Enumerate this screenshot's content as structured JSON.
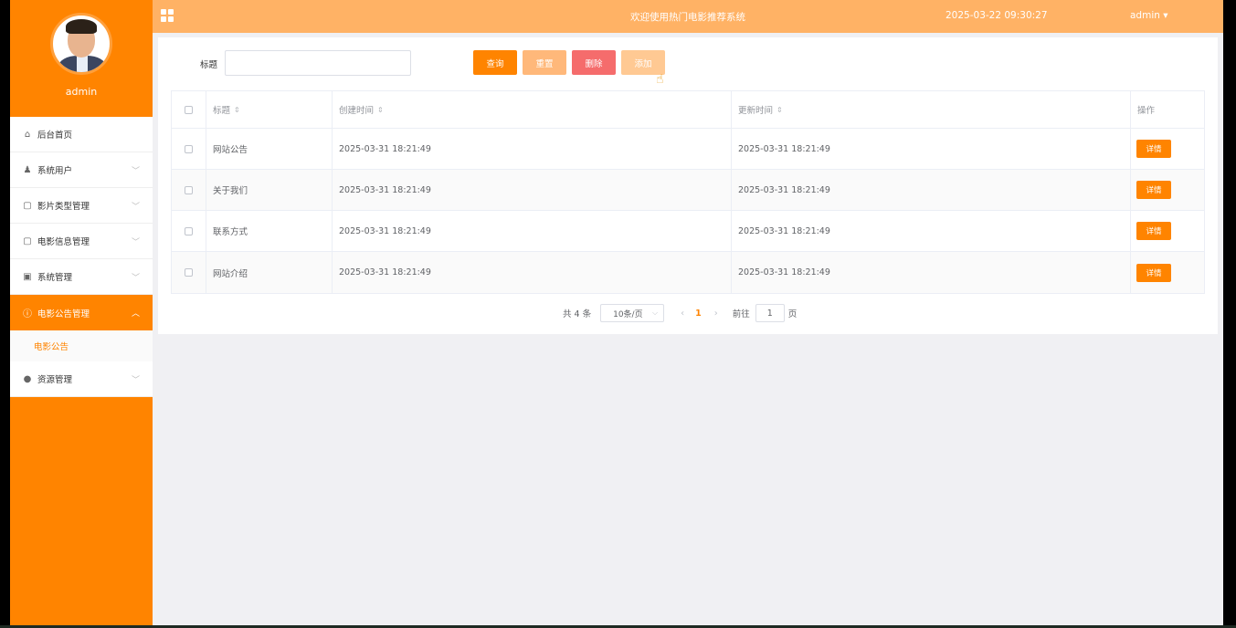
{
  "sidebar": {
    "username": "admin",
    "menu": [
      {
        "label": "后台首页",
        "icon": "home-icon",
        "glyph": "⌂",
        "has_chevron": false
      },
      {
        "label": "系统用户",
        "icon": "user-icon",
        "glyph": "♟",
        "has_chevron": true
      },
      {
        "label": "影片类型管理",
        "icon": "document-icon",
        "glyph": "▢",
        "has_chevron": true
      },
      {
        "label": "电影信息管理",
        "icon": "document-icon",
        "glyph": "▢",
        "has_chevron": true
      },
      {
        "label": "系统管理",
        "icon": "picture-icon",
        "glyph": "▣",
        "has_chevron": true
      },
      {
        "label": "电影公告管理",
        "icon": "info-circle-icon",
        "glyph": "ⓘ",
        "has_chevron": true,
        "active": true
      },
      {
        "label": "资源管理",
        "icon": "location-icon",
        "glyph": "●",
        "has_chevron": true
      }
    ],
    "submenu_active": "电影公告"
  },
  "header": {
    "title": "欢迎使用热门电影推荐系统",
    "datetime": "2025-03-22 09:30:27",
    "user": "admin ▾"
  },
  "search": {
    "label": "标题",
    "value": ""
  },
  "actions": {
    "query": "查询",
    "reset": "重置",
    "delete": "删除",
    "add": "添加"
  },
  "table": {
    "columns": {
      "title": "标题",
      "created": "创建时间",
      "updated": "更新时间",
      "op": "操作"
    },
    "sort_glyph": "⇕",
    "rows": [
      {
        "title": "网站公告",
        "created": "2025-03-31 18:21:49",
        "updated": "2025-03-31 18:21:49",
        "op": "详情"
      },
      {
        "title": "关于我们",
        "created": "2025-03-31 18:21:49",
        "updated": "2025-03-31 18:21:49",
        "op": "详情"
      },
      {
        "title": "联系方式",
        "created": "2025-03-31 18:21:49",
        "updated": "2025-03-31 18:21:49",
        "op": "详情"
      },
      {
        "title": "网站介绍",
        "created": "2025-03-31 18:21:49",
        "updated": "2025-03-31 18:21:49",
        "op": "详情"
      }
    ]
  },
  "pagination": {
    "total": "共 4 条",
    "page_size": "10条/页",
    "prev": "‹",
    "current": "1",
    "next": "›",
    "goto_label": "前往",
    "goto_value": "1",
    "page_suffix": "页"
  },
  "colors": {
    "primary": "#ff8400",
    "header": "#ffb265",
    "danger": "#f56c6c"
  }
}
